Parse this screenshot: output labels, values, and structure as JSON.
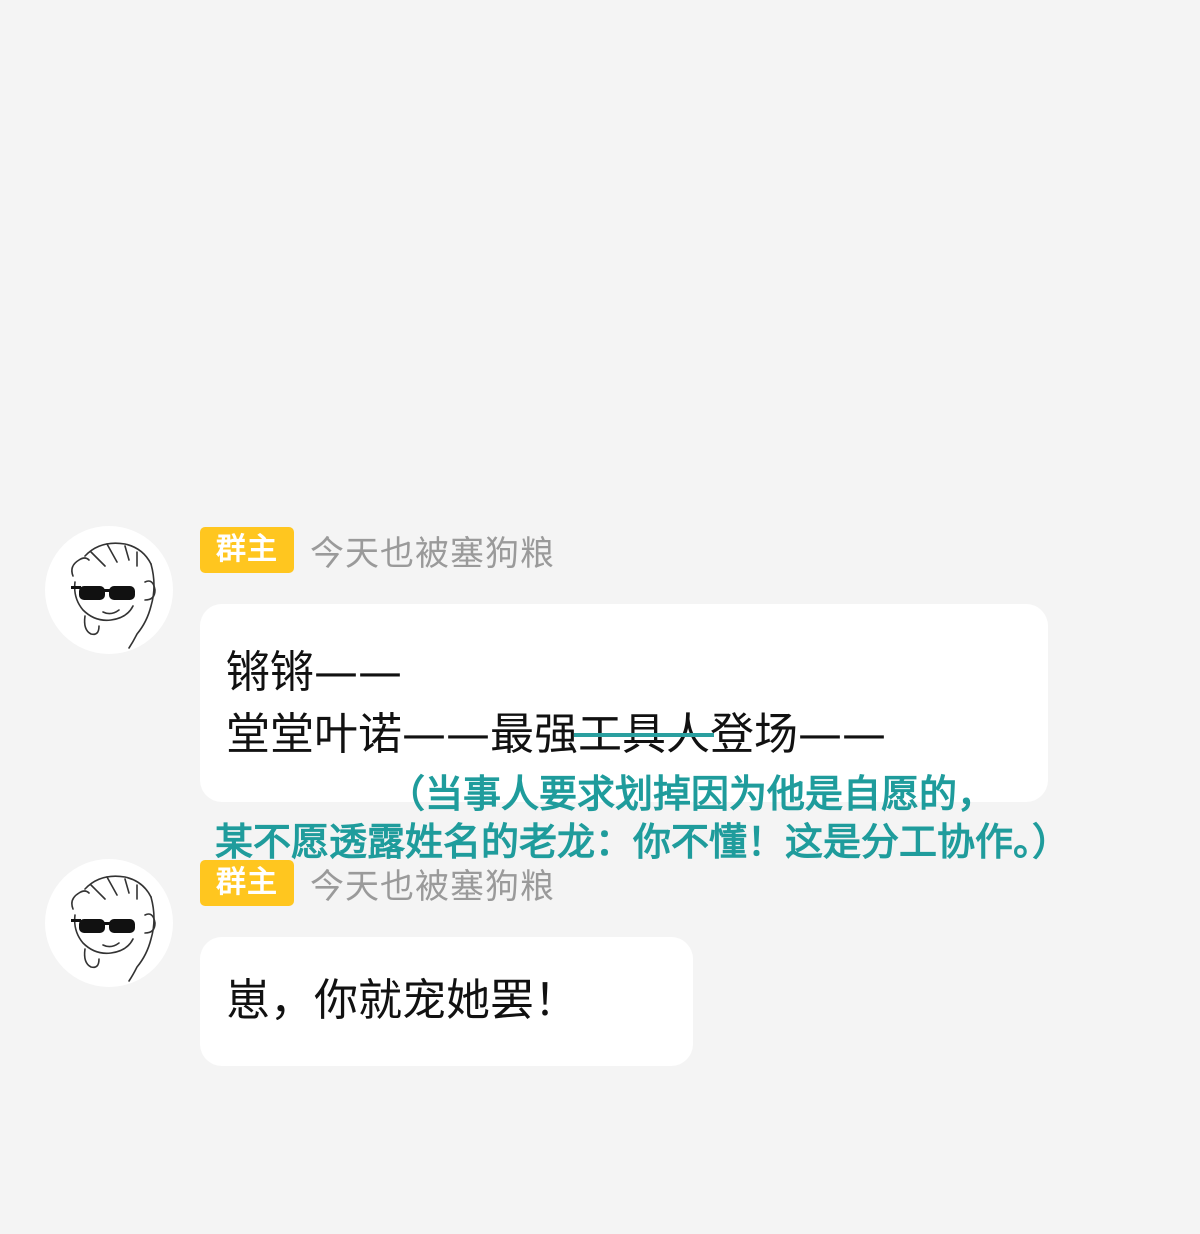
{
  "colors": {
    "background": "#f4f4f4",
    "bubble": "#ffffff",
    "role_badge": "#ffc61f",
    "sender_name": "#9a9a9a",
    "annotation": "#1f9c9c"
  },
  "messages": [
    {
      "avatar_icon": "sunglasses-cartoon-avatar-icon",
      "role_badge": "群主",
      "sender_name": "今天也被塞狗粮",
      "line1": "锵锵——",
      "line2_before": "堂堂叶诺——最强",
      "line2_struck": "工具人",
      "line2_after": "登场——"
    },
    {
      "avatar_icon": "sunglasses-cartoon-avatar-icon",
      "role_badge": "群主",
      "sender_name": "今天也被塞狗粮",
      "line1": "崽，你就宠她罢！"
    }
  ],
  "annotations": [
    "（当事人要求划掉因为他是自愿的，",
    "某不愿透露姓名的老龙：你不懂！这是分工协作。）"
  ]
}
